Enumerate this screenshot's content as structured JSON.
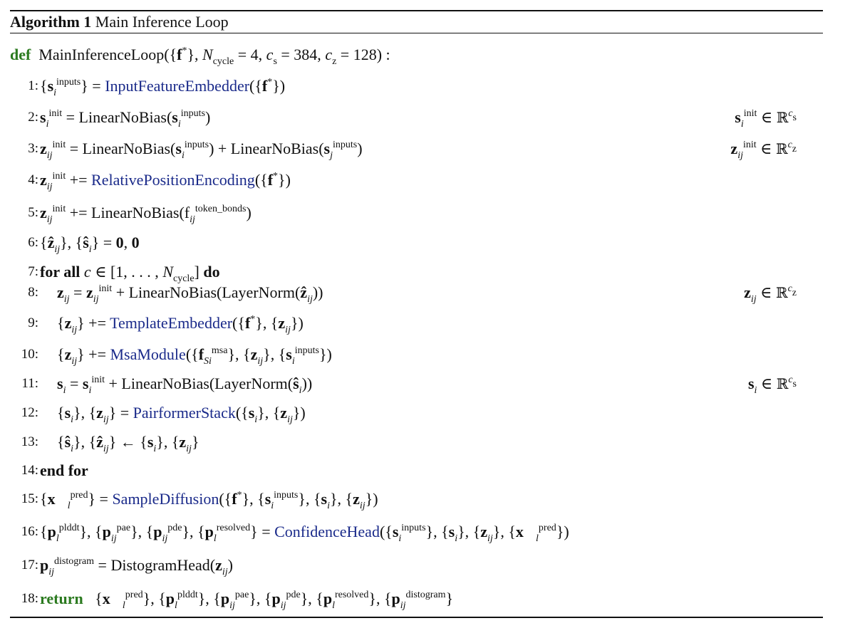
{
  "header": {
    "label": "Algorithm 1",
    "title": "Main Inference Loop"
  },
  "signature": {
    "keyword": "def",
    "name": "MainInferenceLoop"
  },
  "keywords": {
    "for_all": "for all",
    "do": "do",
    "end_for": "end for",
    "return": "return"
  },
  "functions": {
    "input_embedder": "InputFeatureEmbedder",
    "linear_no_bias": "LinearNoBias",
    "rel_pos": "RelativePositionEncoding",
    "layer_norm": "LayerNorm",
    "template": "TemplateEmbedder",
    "msa": "MsaModule",
    "pairformer": "PairformerStack",
    "sample_diffusion": "SampleDiffusion",
    "confidence": "ConfidenceHead",
    "distogram": "DistogramHead"
  },
  "line_numbers": [
    "1:",
    "2:",
    "3:",
    "4:",
    "5:",
    "6:",
    "7:",
    "8:",
    "9:",
    "10:",
    "11:",
    "12:",
    "13:",
    "14:",
    "15:",
    "16:",
    "17:",
    "18:"
  ]
}
